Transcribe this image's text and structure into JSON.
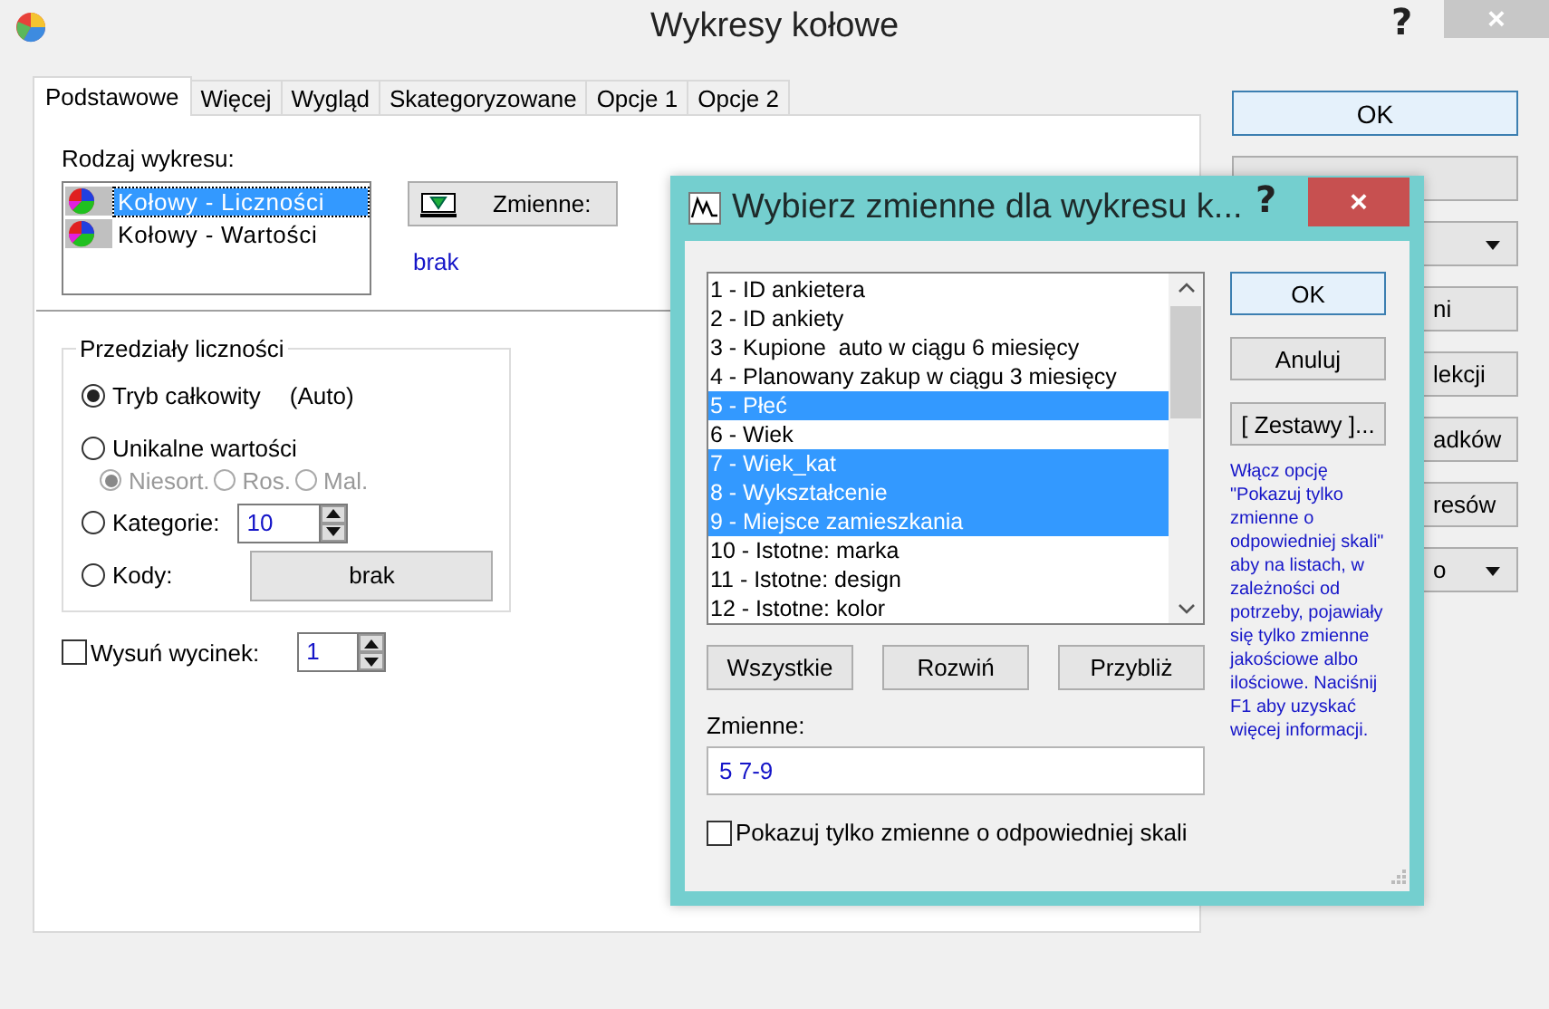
{
  "window": {
    "title": "Wykresy kołowe",
    "help": "?",
    "close": "×"
  },
  "tabs": [
    {
      "label": "Podstawowe",
      "selected": true
    },
    {
      "label": "Więcej",
      "selected": false
    },
    {
      "label": "Wygląd",
      "selected": false
    },
    {
      "label": "Skategoryzowane",
      "selected": false
    },
    {
      "label": "Opcje 1",
      "selected": false
    },
    {
      "label": "Opcje 2",
      "selected": false
    }
  ],
  "chart_type": {
    "label": "Rodzaj wykresu:",
    "items": [
      {
        "label": "Kołowy - Liczności",
        "selected": true
      },
      {
        "label": "Kołowy - Wartości",
        "selected": false
      }
    ]
  },
  "variables": {
    "button": "Zmienne:",
    "value": "brak"
  },
  "intervals": {
    "title": "Przedziały liczności",
    "options": [
      {
        "kind": "plain",
        "label": "Tryb całkowity",
        "note": "(Auto)",
        "selected": true
      },
      {
        "kind": "plain",
        "label": "Unikalne wartości",
        "selected": false
      },
      {
        "kind": "sort",
        "items": [
          {
            "label": "Niesort.",
            "selected": true
          },
          {
            "label": "Ros.",
            "selected": false
          },
          {
            "label": "Mal.",
            "selected": false
          }
        ]
      },
      {
        "kind": "spinner",
        "label": "Kategorie:",
        "value": "10",
        "selected": false
      },
      {
        "kind": "button",
        "label": "Kody:",
        "button": "brak",
        "selected": false
      }
    ]
  },
  "explode": {
    "label": "Wysuń wycinek:",
    "checked": false,
    "value": "1"
  },
  "side_buttons": [
    {
      "kind": "button",
      "label": "OK"
    },
    {
      "kind": "covered"
    },
    {
      "kind": "dropdown"
    },
    {
      "kind": "button",
      "label": "ni"
    },
    {
      "kind": "button",
      "label": "lekcji"
    },
    {
      "kind": "button",
      "label": "adków"
    },
    {
      "kind": "button",
      "label": "resów"
    },
    {
      "kind": "dropdown",
      "label": "o"
    }
  ],
  "dialog": {
    "title": "Wybierz zmienne dla wykresu k...",
    "help": "?",
    "close": "×",
    "variables": [
      {
        "label": "1 - ID ankietera",
        "selected": false
      },
      {
        "label": "2 - ID ankiety",
        "selected": false
      },
      {
        "label": "3 - Kupione  auto w ciągu 6 miesięcy",
        "selected": false
      },
      {
        "label": "4 - Planowany zakup w ciągu 3 miesięcy",
        "selected": false
      },
      {
        "label": "5 - Płeć",
        "selected": true
      },
      {
        "label": "6 - Wiek",
        "selected": false
      },
      {
        "label": "7 - Wiek_kat",
        "selected": true
      },
      {
        "label": "8 - Wykształcenie",
        "selected": true
      },
      {
        "label": "9 - Miejsce zamieszkania",
        "selected": true
      },
      {
        "label": "10 - Istotne: marka",
        "selected": false
      },
      {
        "label": "11 - Istotne: design",
        "selected": false
      },
      {
        "label": "12 - Istotne: kolor",
        "selected": false
      }
    ],
    "side_buttons": [
      "OK",
      "Anuluj",
      "[ Zestawy ]..."
    ],
    "hint": "Włącz opcję \"Pokazuj tylko zmienne o odpowiedniej skali\" aby na listach, w zależności od potrzeby, pojawiały się tylko zmienne jakościowe albo ilościowe. Naciśnij F1 aby uzyskać więcej informacji.",
    "bottom_buttons": [
      "Wszystkie",
      "Rozwiń",
      "Przybliż"
    ],
    "field_label": "Zmienne:",
    "field_value": "5 7-9",
    "filter": {
      "label": "Pokazuj tylko zmienne o odpowiedniej skali",
      "checked": false
    }
  }
}
